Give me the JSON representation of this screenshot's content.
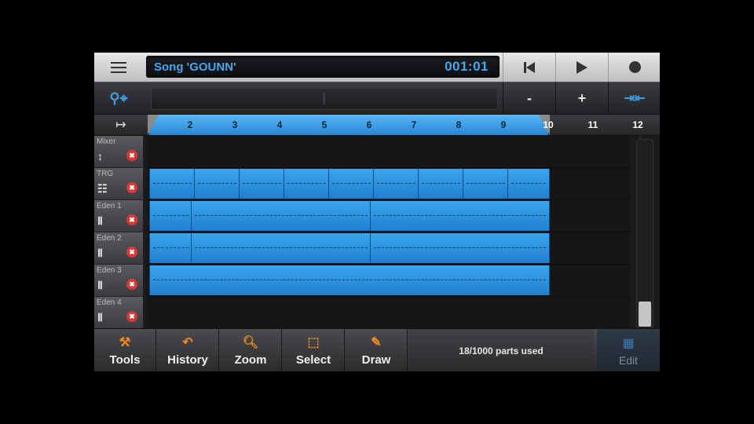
{
  "header": {
    "song_title": "Song 'GOUNN'",
    "time": "001:01"
  },
  "ruler": {
    "bars": [
      "2",
      "3",
      "4",
      "5",
      "6",
      "7",
      "8",
      "9",
      "10",
      "11",
      "12"
    ]
  },
  "tracks": [
    {
      "name": "Mixer",
      "icon": "mixer-icon",
      "glyph": "↕"
    },
    {
      "name": "TRG",
      "icon": "pads-icon",
      "glyph": "☷"
    },
    {
      "name": "Eden 1",
      "icon": "piano-icon",
      "glyph": "Ⅱ"
    },
    {
      "name": "Eden 2",
      "icon": "piano-icon",
      "glyph": "Ⅱ"
    },
    {
      "name": "Eden 3",
      "icon": "piano-icon",
      "glyph": "Ⅱ"
    },
    {
      "name": "Eden 4",
      "icon": "piano-icon",
      "glyph": "Ⅱ"
    }
  ],
  "toolbar": {
    "tools": "Tools",
    "history": "History",
    "zoom": "Zoom",
    "select": "Select",
    "draw": "Draw",
    "status": "18/1000 parts used",
    "edit": "Edit"
  },
  "zoom": {
    "minus": "-",
    "plus": "+"
  },
  "colors": {
    "accent": "#3aa6ee",
    "record": "#d83838",
    "tool_orange": "#f08a20"
  }
}
